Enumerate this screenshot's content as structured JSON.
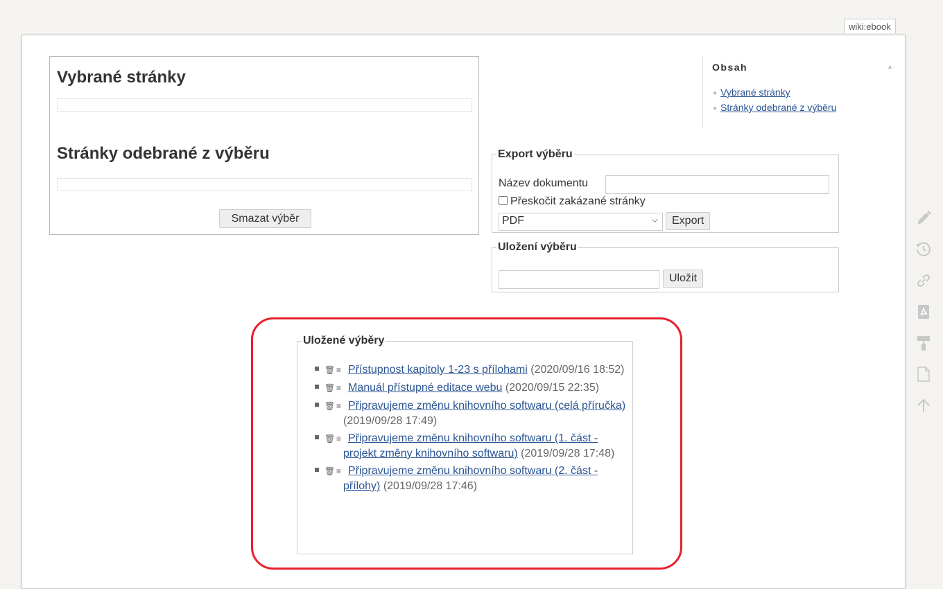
{
  "page_id": "wiki:ebook",
  "selection": {
    "title_selected": "Vybrané stránky",
    "title_removed": "Stránky odebrané z výběru",
    "clear_button": "Smazat výběr"
  },
  "toc": {
    "title": "Obsah",
    "toggle": "▲",
    "items": [
      {
        "label": "Vybrané stránky"
      },
      {
        "label": "Stránky odebrané z výběru"
      }
    ]
  },
  "export": {
    "legend": "Export výběru",
    "doc_name_label": "Název dokumentu",
    "doc_name_value": "",
    "skip_label": "Přeskočit zakázané stránky",
    "skip_checked": false,
    "format_selected": "PDF",
    "export_button": "Export"
  },
  "save": {
    "legend": "Uložení výběru",
    "input_value": "",
    "save_button": "Uložit"
  },
  "saved": {
    "legend": "Uložené výběry",
    "items": [
      {
        "title": "Přístupnost kapitoly 1-23 s přílohami",
        "date": "(2020/09/16 18:52)"
      },
      {
        "title": "Manuál přístupné editace webu",
        "date": "(2020/09/15 22:35)"
      },
      {
        "title": "Připravujeme změnu knihovního softwaru (celá příručka)",
        "date": "(2019/09/28 17:49)"
      },
      {
        "title": "Připravujeme změnu knihovního softwaru (1. část - projekt změny knihovního softwaru)",
        "date": "(2019/09/28 17:48)"
      },
      {
        "title": "Připravujeme změnu knihovního softwaru (2. část - přílohy)",
        "date": "(2019/09/28 17:46)"
      }
    ]
  },
  "tools": [
    {
      "icon": "pencil-icon"
    },
    {
      "icon": "history-icon"
    },
    {
      "icon": "link-icon"
    },
    {
      "icon": "pdf-icon"
    },
    {
      "icon": "paint-roller-icon"
    },
    {
      "icon": "new-page-icon"
    },
    {
      "icon": "arrow-up-icon"
    }
  ],
  "colors": {
    "link": "#2b5593",
    "highlight": "#e8202c",
    "tool_icon": "#c8c8c8"
  }
}
